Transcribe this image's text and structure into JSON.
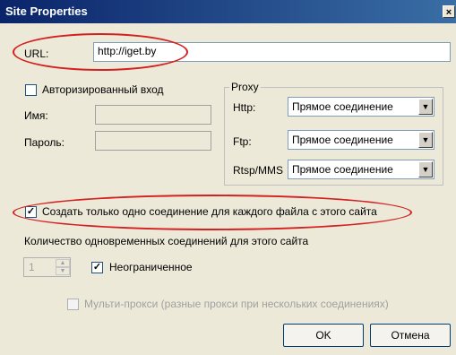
{
  "window": {
    "title": "Site Properties",
    "close_glyph": "×"
  },
  "url": {
    "label": "URL:",
    "value": "http://iget.by"
  },
  "auth": {
    "checkbox_label": "Авторизированный вход",
    "checked": false,
    "name_label": "Имя:",
    "password_label": "Пароль:",
    "name_value": "",
    "password_value": ""
  },
  "proxy": {
    "group_title": "Proxy",
    "http_label": "Http:",
    "http_value": "Прямое соединение",
    "ftp_label": "Ftp:",
    "ftp_value": "Прямое соединение",
    "rtsp_label": "Rtsp/MMS",
    "rtsp_value": "Прямое соединение",
    "dropdown_glyph": "▼"
  },
  "options": {
    "single_connection_label": "Создать только одно соединение для каждого файла с этого сайта",
    "single_connection_checked": true,
    "simultaneous_label": "Количество одновременных соединений для этого сайта",
    "count_value": "1",
    "unlimited_label": "Неограниченное",
    "unlimited_checked": true,
    "multi_proxy_label": "Мульти-прокси (разные прокси при нескольких соединениях)",
    "multi_proxy_checked": false,
    "check_glyph": "✓"
  },
  "buttons": {
    "ok": "OK",
    "cancel": "Отмена"
  },
  "annotation_color": "#d42020"
}
